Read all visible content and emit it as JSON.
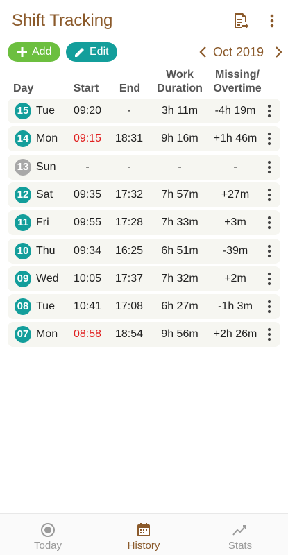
{
  "app": {
    "title": "Shift Tracking"
  },
  "toolbar": {
    "add_label": "Add",
    "edit_label": "Edit",
    "month": "Oct 2019"
  },
  "columns": {
    "day": "Day",
    "start": "Start",
    "end": "End",
    "work_line1": "Work",
    "work_line2": "Duration",
    "missing_line1": "Missing/",
    "missing_line2": "Overtime"
  },
  "colors": {
    "brand": "#8b5a2b",
    "badge_active": "#139e9b",
    "badge_off": "#a8a8a8",
    "late": "#e02020",
    "add": "#6cbf3f"
  },
  "rows": [
    {
      "date": "15",
      "day": "Tue",
      "start": "09:20",
      "end": "-",
      "work": "3h 11m",
      "diff": "-4h 19m",
      "late": false,
      "off": false
    },
    {
      "date": "14",
      "day": "Mon",
      "start": "09:15",
      "end": "18:31",
      "work": "9h 16m",
      "diff": "+1h 46m",
      "late": true,
      "off": false
    },
    {
      "date": "13",
      "day": "Sun",
      "start": "-",
      "end": "-",
      "work": "-",
      "diff": "-",
      "late": false,
      "off": true
    },
    {
      "date": "12",
      "day": "Sat",
      "start": "09:35",
      "end": "17:32",
      "work": "7h 57m",
      "diff": "+27m",
      "late": false,
      "off": false
    },
    {
      "date": "11",
      "day": "Fri",
      "start": "09:55",
      "end": "17:28",
      "work": "7h 33m",
      "diff": "+3m",
      "late": false,
      "off": false
    },
    {
      "date": "10",
      "day": "Thu",
      "start": "09:34",
      "end": "16:25",
      "work": "6h 51m",
      "diff": "-39m",
      "late": false,
      "off": false
    },
    {
      "date": "09",
      "day": "Wed",
      "start": "10:05",
      "end": "17:37",
      "work": "7h 32m",
      "diff": "+2m",
      "late": false,
      "off": false
    },
    {
      "date": "08",
      "day": "Tue",
      "start": "10:41",
      "end": "17:08",
      "work": "6h 27m",
      "diff": "-1h 3m",
      "late": false,
      "off": false
    },
    {
      "date": "07",
      "day": "Mon",
      "start": "08:58",
      "end": "18:54",
      "work": "9h 56m",
      "diff": "+2h 26m",
      "late": true,
      "off": false
    }
  ],
  "nav": {
    "today_label": "Today",
    "history_label": "History",
    "stats_label": "Stats",
    "active": "history"
  }
}
